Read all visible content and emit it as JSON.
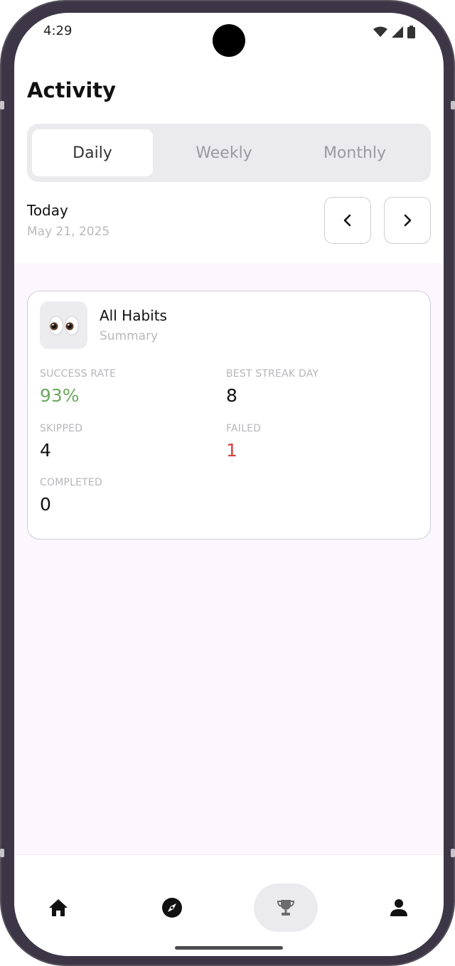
{
  "status": {
    "time": "4:29"
  },
  "header": {
    "title": "Activity"
  },
  "tabs": [
    {
      "label": "Daily",
      "active": true
    },
    {
      "label": "Weekly",
      "active": false
    },
    {
      "label": "Monthly",
      "active": false
    }
  ],
  "date": {
    "label": "Today",
    "value": "May 21, 2025"
  },
  "card": {
    "emoji": "👀",
    "title": "All Habits",
    "subtitle": "Summary",
    "stats": {
      "success_rate_label": "SUCCESS RATE",
      "success_rate_value": "93%",
      "best_streak_label": "BEST STREAK DAY",
      "best_streak_value": "8",
      "skipped_label": "SKIPPED",
      "skipped_value": "4",
      "failed_label": "FAILED",
      "failed_value": "1",
      "completed_label": "COMPLETED",
      "completed_value": "0"
    }
  },
  "colors": {
    "success": "#6aa95e",
    "failed": "#d0443c",
    "content_bg": "#fcf7fe"
  },
  "bottom_nav": [
    {
      "icon": "home-icon",
      "active": false
    },
    {
      "icon": "compass-icon",
      "active": false
    },
    {
      "icon": "trophy-icon",
      "active": true
    },
    {
      "icon": "person-icon",
      "active": false
    }
  ]
}
